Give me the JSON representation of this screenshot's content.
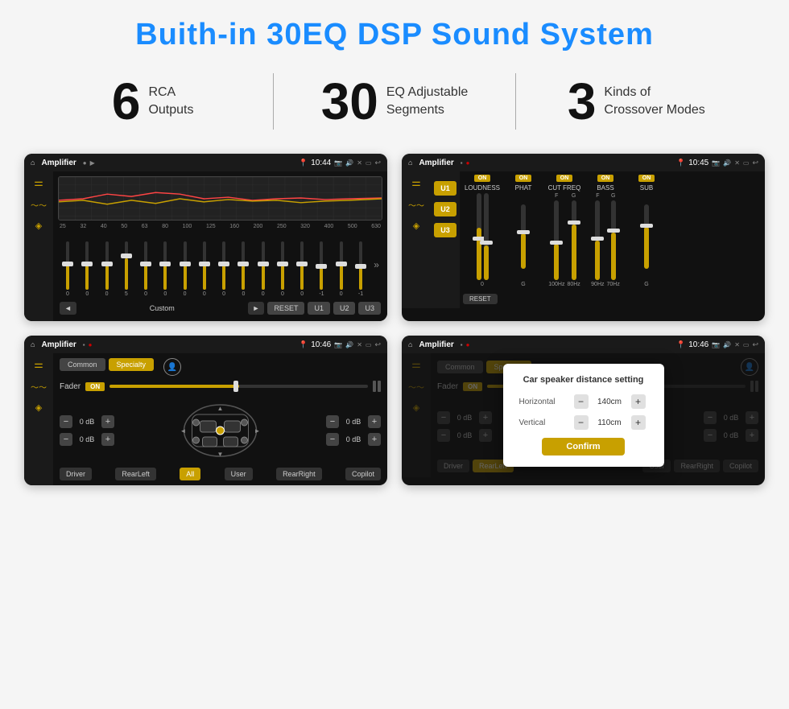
{
  "title": "Buith-in 30EQ DSP Sound System",
  "specs": [
    {
      "number": "6",
      "text_line1": "RCA",
      "text_line2": "Outputs"
    },
    {
      "number": "30",
      "text_line1": "EQ Adjustable",
      "text_line2": "Segments"
    },
    {
      "number": "3",
      "text_line1": "Kinds of",
      "text_line2": "Crossover Modes"
    }
  ],
  "screens": {
    "eq": {
      "app_name": "Amplifier",
      "time": "10:44",
      "freq_labels": [
        "25",
        "32",
        "40",
        "50",
        "63",
        "80",
        "100",
        "125",
        "160",
        "200",
        "250",
        "320",
        "400",
        "500",
        "630"
      ],
      "sliders": [
        0,
        0,
        0,
        5,
        0,
        0,
        0,
        0,
        0,
        0,
        0,
        0,
        0,
        -1,
        0,
        -1
      ],
      "eq_values": [
        "0",
        "0",
        "0",
        "5",
        "0",
        "0",
        "0",
        "0",
        "0",
        "0",
        "0",
        "0",
        "0",
        "-1",
        "0",
        "-1"
      ],
      "preset_label": "Custom",
      "presets": [
        "RESET",
        "U1",
        "U2",
        "U3"
      ]
    },
    "crossover": {
      "app_name": "Amplifier",
      "time": "10:45",
      "u_buttons": [
        "U1",
        "U2",
        "U3"
      ],
      "channels": [
        "LOUDNESS",
        "PHAT",
        "CUT FREQ",
        "BASS",
        "SUB"
      ],
      "on_labels": [
        "ON",
        "ON",
        "ON",
        "ON",
        "ON"
      ],
      "reset_label": "RESET"
    },
    "fader": {
      "app_name": "Amplifier",
      "time": "10:46",
      "tabs": [
        "Common",
        "Specialty"
      ],
      "fader_label": "Fader",
      "on_label": "ON",
      "vol_labels": [
        "0 dB",
        "0 dB",
        "0 dB",
        "0 dB"
      ],
      "bottom_buttons": [
        "Driver",
        "RearLeft",
        "All",
        "User",
        "RearRight",
        "Copilot"
      ]
    },
    "distance": {
      "app_name": "Amplifier",
      "time": "10:46",
      "dialog_title": "Car speaker distance setting",
      "horizontal_label": "Horizontal",
      "horizontal_value": "140cm",
      "vertical_label": "Vertical",
      "vertical_value": "110cm",
      "confirm_label": "Confirm",
      "vol_labels": [
        "0 dB",
        "0 dB"
      ]
    }
  },
  "icons": {
    "home": "⌂",
    "location": "📍",
    "camera": "📷",
    "volume": "🔊",
    "x": "✕",
    "window": "▭",
    "back": "↩",
    "eq_icon": "≡",
    "wave_icon": "〜",
    "speaker_icon": "◉",
    "arrow_left": "◄",
    "arrow_right": "►",
    "minus": "−",
    "plus": "+"
  }
}
